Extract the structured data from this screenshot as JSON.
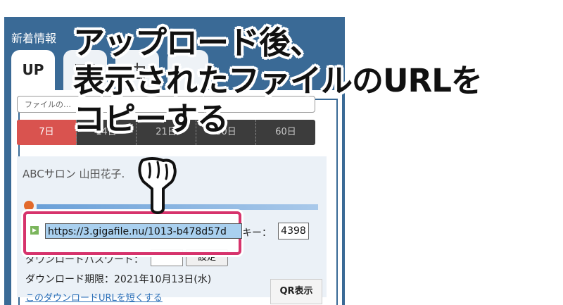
{
  "panel": {
    "title": "新着情報"
  },
  "tabs": [
    {
      "label": "UP"
    },
    {
      "icon": "mail-icon"
    },
    {
      "icon": "upload-icon"
    },
    {
      "icon": "blank"
    }
  ],
  "search": {
    "placeholder": "ファイルの…"
  },
  "days": [
    "7日",
    "14日",
    "21日",
    "30日",
    "60日"
  ],
  "file": {
    "name": "ABCサロン 山田花子.",
    "url": "https://3.gigafile.nu/1013-b478d57d",
    "delete_label": "削除キー：",
    "delete_key": "4398",
    "password_label": "ダウンロードパスワード：",
    "set_button": "設定",
    "expiry": "ダウンロード期限：2021年10月13日(水)",
    "shorten_link": "このダウンロードURLを短くする",
    "qr_button": "QR表示",
    "progress": 1.0
  },
  "callout": {
    "line1": "アップロード後、",
    "line2": "表示されたファイルのURLを",
    "line3": "コピーする"
  },
  "colors": {
    "panel": "#3a6a96",
    "active_day": "#d9534f",
    "highlight": "#d6336c"
  }
}
